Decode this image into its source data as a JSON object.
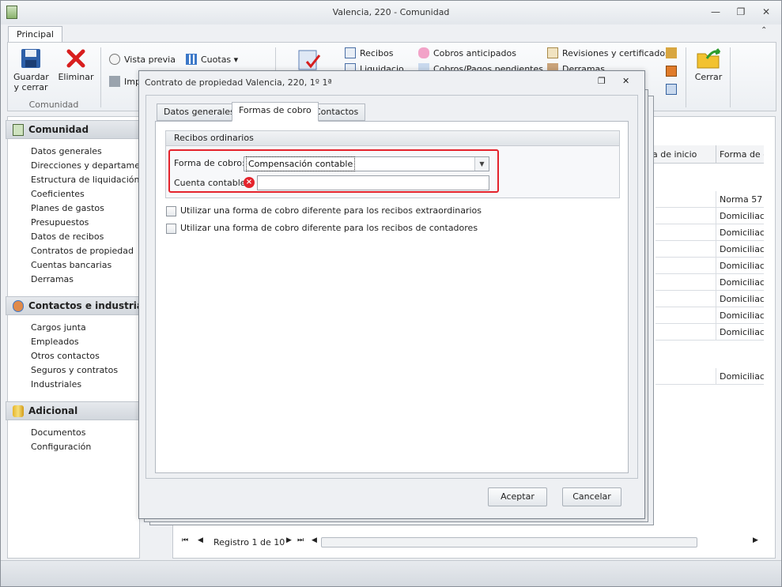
{
  "window": {
    "title": "Valencia, 220 - Comunidad"
  },
  "ribbon": {
    "tab": "Principal",
    "save_label": "Guardar y cerrar",
    "delete_label": "Eliminar",
    "group_label": "Comunidad",
    "preview_label": "Vista previa",
    "print_label": "Imp",
    "quotas_label": "Cuotas",
    "receipts_label": "Recibos",
    "receipts_sub": "Liquidacio...",
    "advance_label": "Cobros anticipados",
    "advance_sub": "Cobros/Pagos pendientes",
    "reviews_label": "Revisiones y certificados",
    "reviews_sub": "Derramas",
    "close_label": "Cerrar"
  },
  "nav": {
    "comunidad": {
      "title": "Comunidad",
      "items": [
        "Datos generales",
        "Direcciones y departamentos",
        "Estructura de liquidación",
        "Coeficientes",
        "Planes de gastos",
        "Presupuestos",
        "Datos de recibos",
        "Contratos de propiedad",
        "Cuentas bancarias",
        "Derramas"
      ]
    },
    "contactos": {
      "title": "Contactos e industriales",
      "items": [
        "Cargos junta",
        "Empleados",
        "Otros contactos",
        "Seguros y contratos",
        "Industriales"
      ]
    },
    "adicional": {
      "title": "Adicional",
      "items": [
        "Documentos",
        "Configuración"
      ]
    }
  },
  "grid": {
    "headers": [
      "ha de inicio",
      "Forma de co"
    ],
    "rows": [
      "Norma 57",
      "Domiciliación",
      "Domiciliación",
      "Domiciliación",
      "Domiciliación",
      "Domiciliación",
      "Domiciliación",
      "Domiciliación",
      "Domiciliación",
      "Domiciliación"
    ],
    "record_label": "Registro 1 de 10"
  },
  "dialog": {
    "title": "Contrato de propiedad Valencia, 220, 1º 1ª",
    "tabs": [
      "Datos generales",
      "Formas de cobro",
      "Contactos"
    ],
    "group_title": "Recibos ordinarios",
    "payment_label": "Forma de cobro:",
    "payment_value": "Compensación contable",
    "account_label": "Cuenta contable:",
    "account_value": "",
    "check_extra": "Utilizar una forma de cobro diferente para los recibos extraordinarios",
    "check_meters": "Utilizar una forma de cobro diferente para los recibos de contadores",
    "accept_label": "Aceptar",
    "cancel_label": "Cancelar"
  },
  "colors": {
    "error": "#e4232c",
    "highlight": "#e4232c"
  }
}
